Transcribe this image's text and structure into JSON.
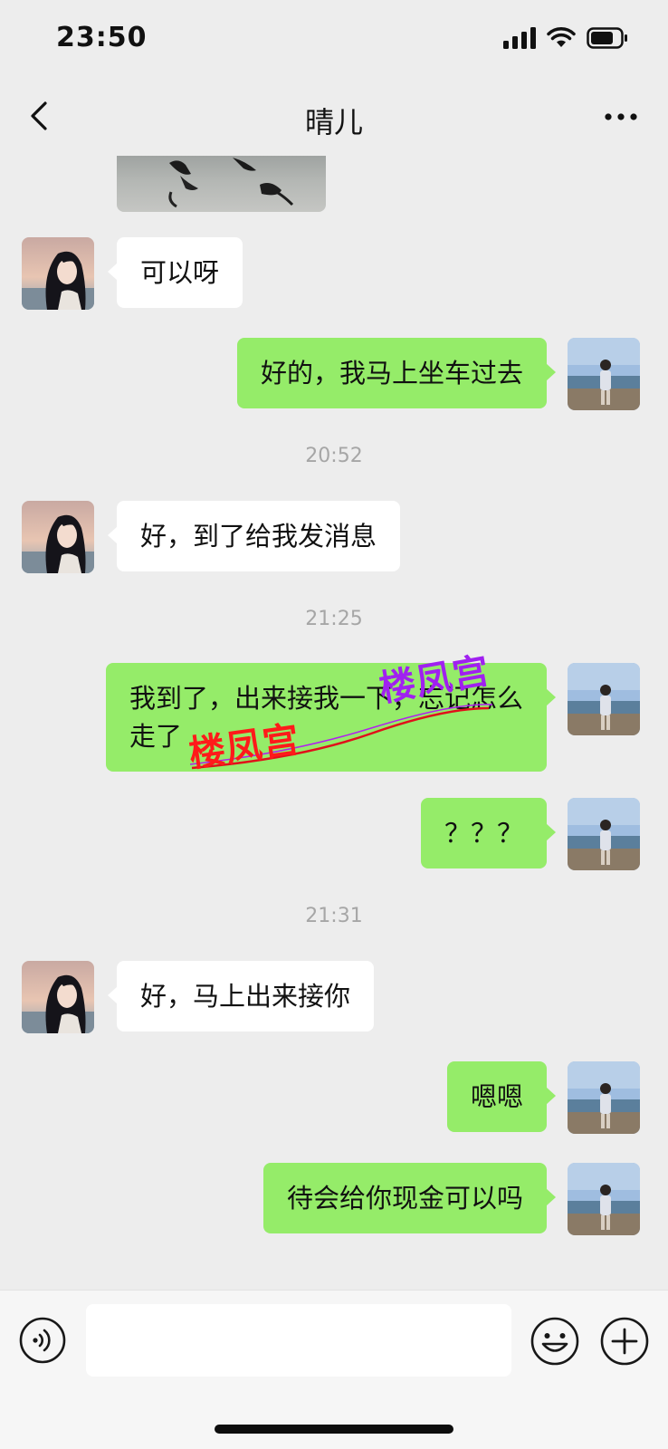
{
  "status_bar": {
    "time": "23:50",
    "icons": [
      "cellular-signal-icon",
      "wifi-icon",
      "battery-icon"
    ]
  },
  "nav": {
    "title": "晴儿",
    "icons": [
      "back-chevron-icon",
      "more-dots-icon"
    ]
  },
  "messages": [
    {
      "side": "in",
      "text": "可以呀"
    },
    {
      "side": "out",
      "text": "好的，我马上坐车过去"
    },
    {
      "time": "20:52"
    },
    {
      "side": "in",
      "text": "好，到了给我发消息"
    },
    {
      "time": "21:25"
    },
    {
      "side": "out",
      "text": "我到了，出来接我一下，忘记怎么走了"
    },
    {
      "side": "out",
      "text": "？？？"
    },
    {
      "time": "21:31"
    },
    {
      "side": "in",
      "text": "好，马上出来接你"
    },
    {
      "side": "out",
      "text": "嗯嗯"
    },
    {
      "side": "out",
      "text": "待会给你现金可以吗"
    }
  ],
  "watermark": {
    "text_1": "楼凤宫",
    "text_2": "楼凤宫",
    "colors": [
      "#ff1a1a",
      "#a020f0"
    ]
  },
  "input_bar": {
    "placeholder": "",
    "icons": [
      "voice-icon",
      "emoji-icon",
      "plus-icon"
    ]
  },
  "colors": {
    "background": "#ededed",
    "outgoing_bubble": "#95ec69",
    "incoming_bubble": "#ffffff",
    "timestamp_text": "#a6a6a6"
  }
}
